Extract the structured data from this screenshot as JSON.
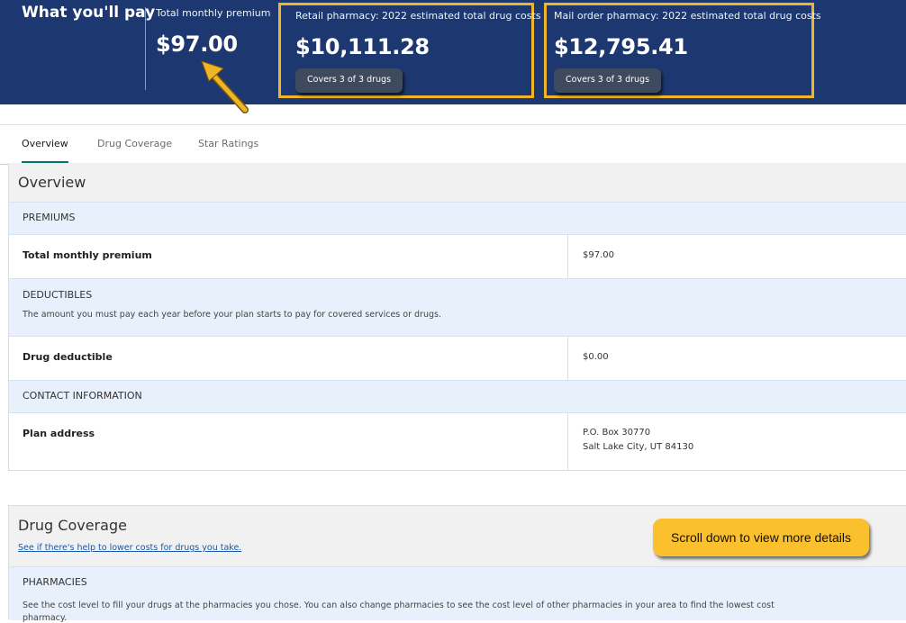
{
  "header": {
    "title": "What you'll pay",
    "premium": {
      "label": "Total monthly premium",
      "amount": "$97.00"
    },
    "retail": {
      "label": "Retail pharmacy: 2022 estimated total drug costs",
      "amount": "$10,111.28",
      "coverage": "Covers 3 of 3 drugs"
    },
    "mail": {
      "label": "Mail order pharmacy: 2022 estimated total drug costs",
      "amount": "$12,795.41",
      "coverage": "Covers 3 of 3 drugs"
    }
  },
  "tabs": [
    {
      "label": "Overview",
      "active": true
    },
    {
      "label": "Drug Coverage",
      "active": false
    },
    {
      "label": "Star Ratings",
      "active": false
    }
  ],
  "overview": {
    "title": "Overview",
    "premiums": {
      "heading": "PREMIUMS",
      "row_label": "Total monthly premium",
      "row_value": "$97.00"
    },
    "deductibles": {
      "heading": "DEDUCTIBLES",
      "description": "The amount you must pay each year before your plan starts to pay for covered services or drugs.",
      "row_label": "Drug deductible",
      "row_value": "$0.00"
    },
    "contact": {
      "heading": "CONTACT INFORMATION",
      "row_label": "Plan address",
      "address_line1": "P.O. Box 30770",
      "address_line2": "Salt Lake City, UT 84130"
    }
  },
  "drug_coverage": {
    "title": "Drug Coverage",
    "link": "See if there's help to lower costs for drugs you take.",
    "pharmacies_heading": "PHARMACIES",
    "pharmacies_desc_line1": "See the cost level to fill your drugs at the pharmacies you chose. You can also change pharmacies to see the cost level of other pharmacies in your area to find the lowest cost",
    "pharmacies_desc_line2": "pharmacy."
  },
  "callout": "Scroll down to view more details",
  "colors": {
    "header_bg": "#1d3870",
    "highlight": "#f0b429",
    "active_tab": "#00796b",
    "callout_bg": "#fbc02d"
  }
}
